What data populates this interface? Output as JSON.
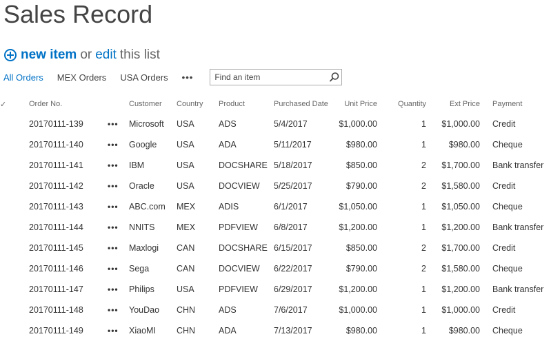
{
  "page": {
    "title": "Sales Record"
  },
  "actions": {
    "new_item_label": "new item",
    "or_text": "or",
    "edit_label": "edit",
    "this_list_text": "this list"
  },
  "views": {
    "tabs": [
      {
        "label": "All Orders",
        "active": true
      },
      {
        "label": "MEX Orders",
        "active": false
      },
      {
        "label": "USA Orders",
        "active": false
      }
    ],
    "more_label": "•••",
    "search_placeholder": "Find an item"
  },
  "table": {
    "check_header": "✓",
    "columns": {
      "order_no": "Order No.",
      "customer": "Customer",
      "country": "Country",
      "product": "Product",
      "purchased_date": "Purchased Date",
      "unit_price": "Unit Price",
      "quantity": "Quantity",
      "ext_price": "Ext Price",
      "payment": "Payment"
    },
    "row_menu_label": "•••",
    "rows": [
      {
        "order_no": "20170111-139",
        "customer": "Microsoft",
        "country": "USA",
        "product": "ADS",
        "purchased_date": "5/4/2017",
        "unit_price": "$1,000.00",
        "quantity": "1",
        "ext_price": "$1,000.00",
        "payment": "Credit"
      },
      {
        "order_no": "20170111-140",
        "customer": "Google",
        "country": "USA",
        "product": "ADA",
        "purchased_date": "5/11/2017",
        "unit_price": "$980.00",
        "quantity": "1",
        "ext_price": "$980.00",
        "payment": "Cheque"
      },
      {
        "order_no": "20170111-141",
        "customer": "IBM",
        "country": "USA",
        "product": "DOCSHARE",
        "purchased_date": "5/18/2017",
        "unit_price": "$850.00",
        "quantity": "2",
        "ext_price": "$1,700.00",
        "payment": "Bank transfer"
      },
      {
        "order_no": "20170111-142",
        "customer": "Oracle",
        "country": "USA",
        "product": "DOCVIEW",
        "purchased_date": "5/25/2017",
        "unit_price": "$790.00",
        "quantity": "2",
        "ext_price": "$1,580.00",
        "payment": "Credit"
      },
      {
        "order_no": "20170111-143",
        "customer": "ABC.com",
        "country": "MEX",
        "product": "ADIS",
        "purchased_date": "6/1/2017",
        "unit_price": "$1,050.00",
        "quantity": "1",
        "ext_price": "$1,050.00",
        "payment": "Cheque"
      },
      {
        "order_no": "20170111-144",
        "customer": "NNITS",
        "country": "MEX",
        "product": "PDFVIEW",
        "purchased_date": "6/8/2017",
        "unit_price": "$1,200.00",
        "quantity": "1",
        "ext_price": "$1,200.00",
        "payment": "Bank transfer"
      },
      {
        "order_no": "20170111-145",
        "customer": "Maxlogi",
        "country": "CAN",
        "product": "DOCSHARE",
        "purchased_date": "6/15/2017",
        "unit_price": "$850.00",
        "quantity": "2",
        "ext_price": "$1,700.00",
        "payment": "Credit"
      },
      {
        "order_no": "20170111-146",
        "customer": "Sega",
        "country": "CAN",
        "product": "DOCVIEW",
        "purchased_date": "6/22/2017",
        "unit_price": "$790.00",
        "quantity": "2",
        "ext_price": "$1,580.00",
        "payment": "Cheque"
      },
      {
        "order_no": "20170111-147",
        "customer": "Philips",
        "country": "USA",
        "product": "PDFVIEW",
        "purchased_date": "6/29/2017",
        "unit_price": "$1,200.00",
        "quantity": "1",
        "ext_price": "$1,200.00",
        "payment": "Bank transfer"
      },
      {
        "order_no": "20170111-148",
        "customer": "YouDao",
        "country": "CHN",
        "product": "ADS",
        "purchased_date": "7/6/2017",
        "unit_price": "$1,000.00",
        "quantity": "1",
        "ext_price": "$1,000.00",
        "payment": "Credit"
      },
      {
        "order_no": "20170111-149",
        "customer": "XiaoMI",
        "country": "CHN",
        "product": "ADA",
        "purchased_date": "7/13/2017",
        "unit_price": "$980.00",
        "quantity": "1",
        "ext_price": "$980.00",
        "payment": "Cheque"
      }
    ]
  },
  "colors": {
    "accent": "#0072c6",
    "text": "#333333",
    "header_text": "#666666"
  }
}
